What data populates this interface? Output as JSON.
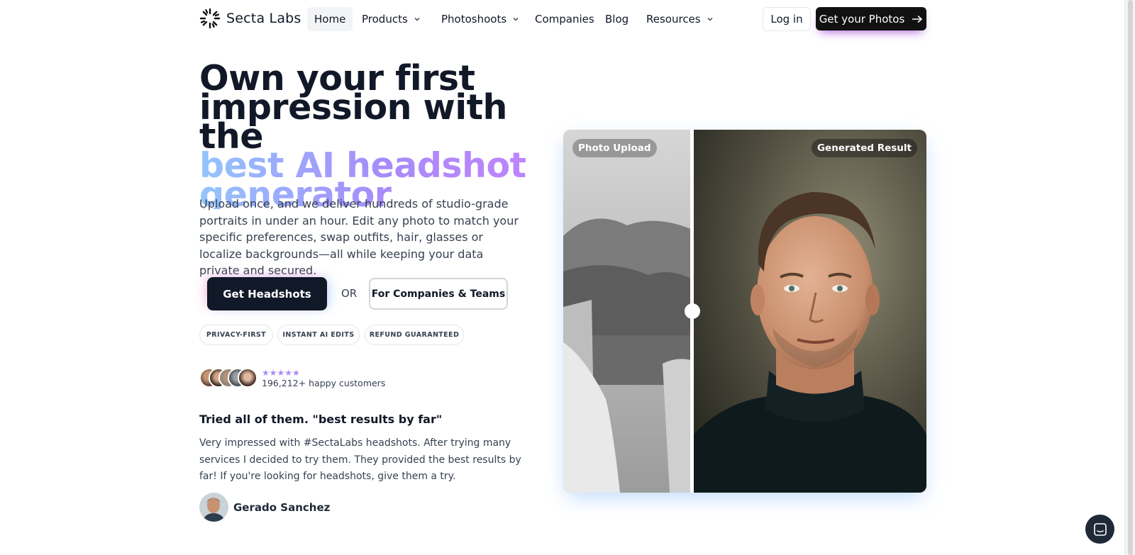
{
  "nav": {
    "logo_text": "Secta Labs",
    "items": [
      {
        "label": "Home",
        "active": true
      },
      {
        "label": "Products",
        "dropdown": true
      },
      {
        "label": "Photoshoots",
        "dropdown": true
      },
      {
        "label": "Companies"
      },
      {
        "label": "Blog"
      },
      {
        "label": "Resources",
        "dropdown": true
      }
    ],
    "login_label": "Log in",
    "cta_label": "Get your Photos"
  },
  "hero": {
    "title_line1": "Own your first",
    "title_line2": "impression with the",
    "title_highlight1": "best AI headshot",
    "title_highlight2": "generator",
    "description": "Upload once, and we deliver hundreds of studio-grade portraits in under an hour. Edit any photo to match your specific preferences, swap outfits, hair, glasses or localize backgrounds—all while keeping your data private and secured.",
    "primary_button": "Get Headshots",
    "or_label": "OR",
    "secondary_button": "For Companies & Teams",
    "pills": [
      "privacy-first",
      "instant ai edits",
      "refund guaranteed"
    ],
    "stars": "★★★★★",
    "customers": "196,212+ happy customers"
  },
  "testimonial": {
    "title": "Tried all of them. \"best results by far\"",
    "body": "Very impressed with #SectaLabs headshots. After trying many services I decided to try them. They provided the best results by far! If you're looking for headshots, give them a try.",
    "author": "Gerado Sanchez"
  },
  "comparison": {
    "left_label": "Photo Upload",
    "right_label": "Generated Result"
  },
  "colors": {
    "accent_gradient_start": "#93c5fd",
    "accent_gradient_end": "#c084fc",
    "dark": "#111827"
  },
  "icons": {
    "logo": "sunburst-icon",
    "chevron": "chevron-down-icon",
    "arrow": "arrow-right-icon",
    "chat": "chat-icon"
  }
}
